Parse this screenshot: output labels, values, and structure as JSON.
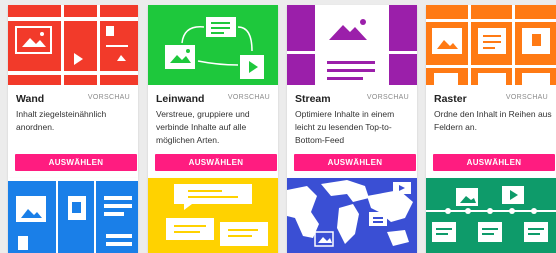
{
  "preview_label": "VORSCHAU",
  "select_label": "AUSWÄHLEN",
  "cards": [
    {
      "title": "Wand",
      "desc": "Inhalt ziegelsteinähnlich anordnen.",
      "color": "#f23a2a"
    },
    {
      "title": "Leinwand",
      "desc": "Verstreue, gruppiere und verbinde Inhalte auf alle möglichen Arten.",
      "color": "#1ec83c"
    },
    {
      "title": "Stream",
      "desc": "Optimiere Inhalte in einem leicht zu lesenden Top-to-Bottom-Feed",
      "color": "#9b1faa"
    },
    {
      "title": "Raster",
      "desc": "Ordne den Inhalt in Reihen aus Feldern an.",
      "color": "#ff7a14"
    }
  ],
  "bottom_cards": [
    {
      "color": "#1a7fe8"
    },
    {
      "color": "#ffd200"
    },
    {
      "color": "#3a4fd4"
    },
    {
      "color": "#0e9b6a"
    }
  ]
}
